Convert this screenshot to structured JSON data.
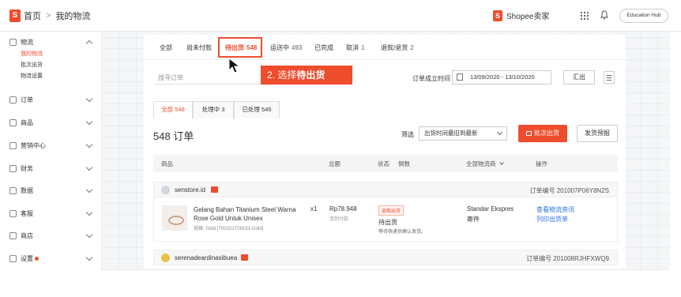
{
  "header": {
    "home_label": "首页",
    "separator": ">",
    "current_label": "我的物流",
    "seller_label": "Shopee卖家",
    "edu_hub_label": "Education Hub"
  },
  "sidebar": {
    "items": [
      {
        "label": "物流",
        "expanded": true,
        "icon": "truck-icon"
      },
      {
        "label": "订单",
        "icon": "order-icon"
      },
      {
        "label": "商品",
        "icon": "product-icon"
      },
      {
        "label": "营销中心",
        "icon": "marketing-icon"
      },
      {
        "label": "财务",
        "icon": "finance-icon"
      },
      {
        "label": "数据",
        "icon": "data-icon"
      },
      {
        "label": "客服",
        "icon": "service-icon"
      },
      {
        "label": "商店",
        "icon": "shop-icon"
      },
      {
        "label": "设置",
        "icon": "settings-icon"
      }
    ],
    "subitems": [
      {
        "label": "我的物流",
        "active": true
      },
      {
        "label": "批次出货"
      },
      {
        "label": "物流设置"
      }
    ]
  },
  "tabs": [
    {
      "label": "全部",
      "count": ""
    },
    {
      "label": "尚未付款",
      "count": ""
    },
    {
      "label": "待出货",
      "count": "548",
      "active": true
    },
    {
      "label": "运送中",
      "count": "493"
    },
    {
      "label": "已完成",
      "count": ""
    },
    {
      "label": "取消",
      "count": "1"
    },
    {
      "label": "退款/退货",
      "count": "2"
    }
  ],
  "search": {
    "placeholder": "搜寻订单"
  },
  "callout": {
    "prefix": "2. 选择",
    "bold": "待出货"
  },
  "date_filter": {
    "label": "订单成立时间",
    "range": "13/09/2020 - 13/10/2020"
  },
  "export_label": "汇出",
  "subtabs": [
    {
      "label": "全部 548",
      "active": true
    },
    {
      "label": "处理中 3"
    },
    {
      "label": "已处理 545"
    }
  ],
  "order_title": "548 订单",
  "filter": {
    "label": "筛选",
    "value": "出货时间最旧到最新"
  },
  "ship_button": "批次出货",
  "predict_button": "发货预报",
  "table_headers": {
    "product": "商品",
    "total": "总额",
    "status": "状态",
    "countdown": "倒数",
    "carrier": "全部物流商",
    "action": "操作"
  },
  "orders": [
    {
      "shop": "senstore.id",
      "order_no": "订单编号 201007P06Y8N2S",
      "product_name": "Gelang Bahan Titanium Steel Warna Rose Gold Untuk Unisex",
      "qty": "x1",
      "spec": "规格: Gold [T00151T00151-Gold]",
      "price": "Rp78.948",
      "price_sub": "货到付款",
      "status_badge": "逾期出货",
      "status": "待出货",
      "status_note": "等待快递员确认发货。",
      "carrier": "Standar Ekspres",
      "carrier_sub": "寄件",
      "action_1": "查看物流资讯",
      "action_2": "列印出货单"
    },
    {
      "shop": "serenadeardinasibuea",
      "order_no": "订单编号 201008RJHFXWQ9"
    }
  ],
  "colors": {
    "accent": "#ee4d2d",
    "link": "#2673dd"
  }
}
